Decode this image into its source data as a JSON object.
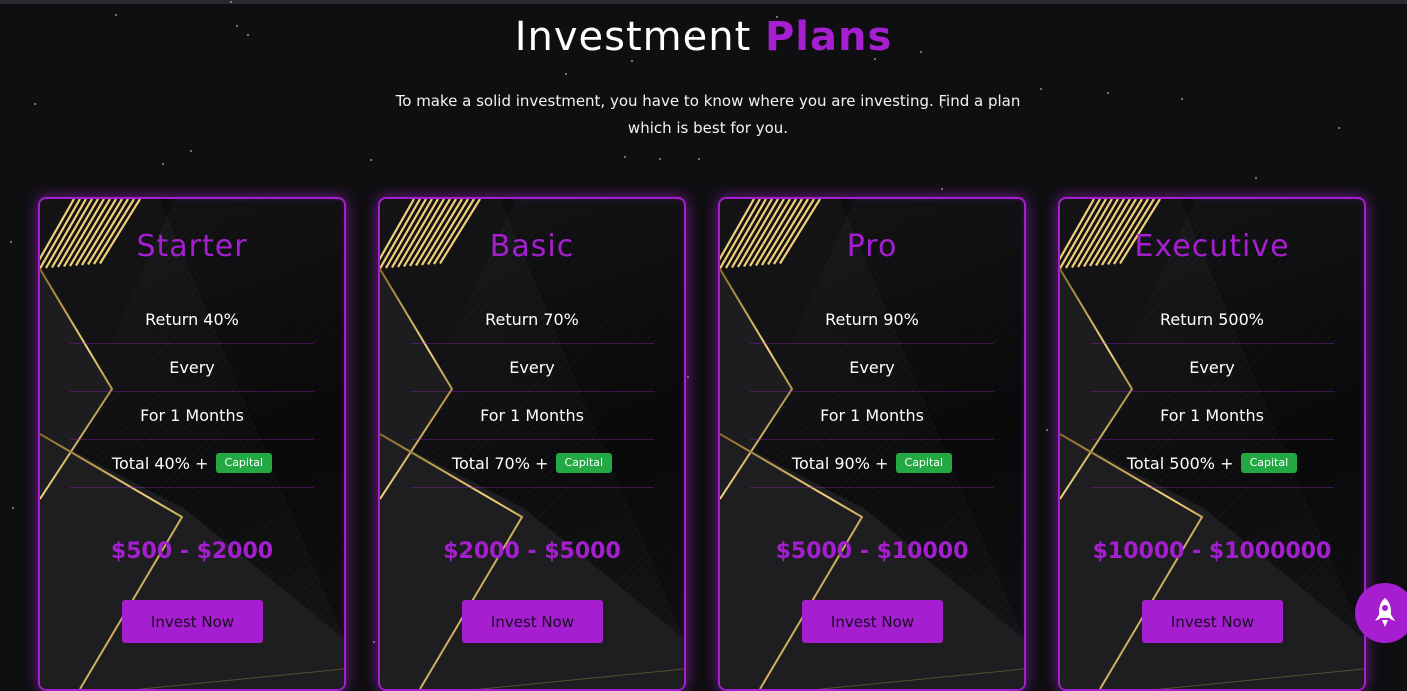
{
  "section": {
    "title_main": "Investment",
    "title_accent": "Plans",
    "subtitle": "To make a solid investment, you have to know where you are investing. Find a plan which is best for you."
  },
  "plans": [
    {
      "name": "Starter",
      "return": "Return 40%",
      "every": "Every",
      "duration": "For 1 Months",
      "total": "Total 40% +",
      "capital": "Capital",
      "range": "$500 - $2000",
      "cta": "Invest Now"
    },
    {
      "name": "Basic",
      "return": "Return 70%",
      "every": "Every",
      "duration": "For 1 Months",
      "total": "Total 70% +",
      "capital": "Capital",
      "range": "$2000 - $5000",
      "cta": "Invest Now"
    },
    {
      "name": "Pro",
      "return": "Return 90%",
      "every": "Every",
      "duration": "For 1 Months",
      "total": "Total 90% +",
      "capital": "Capital",
      "range": "$5000 - $10000",
      "cta": "Invest Now"
    },
    {
      "name": "Executive",
      "return": "Return 500%",
      "every": "Every",
      "duration": "For 1 Months",
      "total": "Total 500% +",
      "capital": "Capital",
      "range": "$10000 - $1000000",
      "cta": "Invest Now"
    }
  ],
  "floating": {
    "icon": "rocket-icon"
  },
  "colors": {
    "accent": "#a51fd0",
    "capital_badge": "#24a844",
    "background": "#0f0f11",
    "gold": "#c9a24a"
  }
}
